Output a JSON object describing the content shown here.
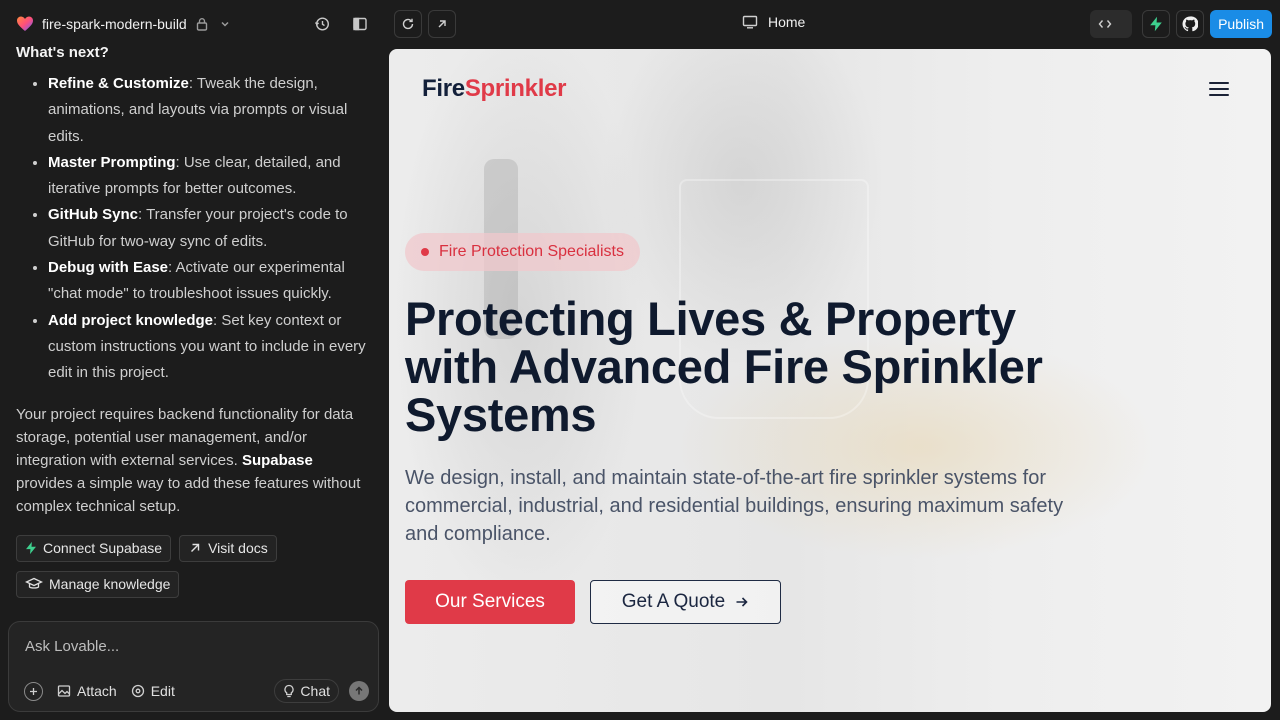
{
  "project": {
    "name": "fire-spark-modern-build"
  },
  "toolbar": {
    "page_label": "Home",
    "publish_label": "Publish"
  },
  "chat": {
    "heading": "What's next?",
    "items": [
      {
        "title": "Refine & Customize",
        "text": ": Tweak the design, animations, and layouts via prompts or visual edits."
      },
      {
        "title": "Master Prompting",
        "text": ": Use clear, detailed, and iterative prompts for better outcomes."
      },
      {
        "title": "GitHub Sync",
        "text": ": Transfer your project's code to GitHub for two-way sync of edits."
      },
      {
        "title": "Debug with Ease",
        "text": ": Activate our experimental \"chat mode\" to troubleshoot issues quickly."
      },
      {
        "title": "Add project knowledge",
        "text": ": Set key context or custom instructions you want to include in every edit in this project."
      }
    ],
    "backend_text_1": "Your project requires backend functionality for data storage, potential user management, and/or integration with external services. ",
    "backend_bold": "Supabase",
    "backend_text_2": " provides a simple way to add these features without complex technical setup.",
    "actions": {
      "connect_supabase": "Connect Supabase",
      "visit_docs": "Visit docs",
      "manage_knowledge": "Manage knowledge"
    }
  },
  "input": {
    "placeholder": "Ask Lovable...",
    "attach_label": "Attach",
    "edit_label": "Edit",
    "chat_label": "Chat"
  },
  "site": {
    "brand_part1": "Fire",
    "brand_part2": "Sprinkler",
    "badge": "Fire Protection Specialists",
    "title": "Protecting Lives & Property with Advanced Fire Sprinkler Systems",
    "subtitle": "We design, install, and maintain state-of-the-art fire sprinkler systems for commercial, industrial, and residential buildings, ensuring maximum safety and compliance.",
    "primary_cta": "Our Services",
    "secondary_cta": "Get A Quote"
  },
  "colors": {
    "accent_red": "#e03a48",
    "navy": "#0f1a2e",
    "publish_blue": "#1a8ce6",
    "supabase_green": "#3ecf8e"
  }
}
